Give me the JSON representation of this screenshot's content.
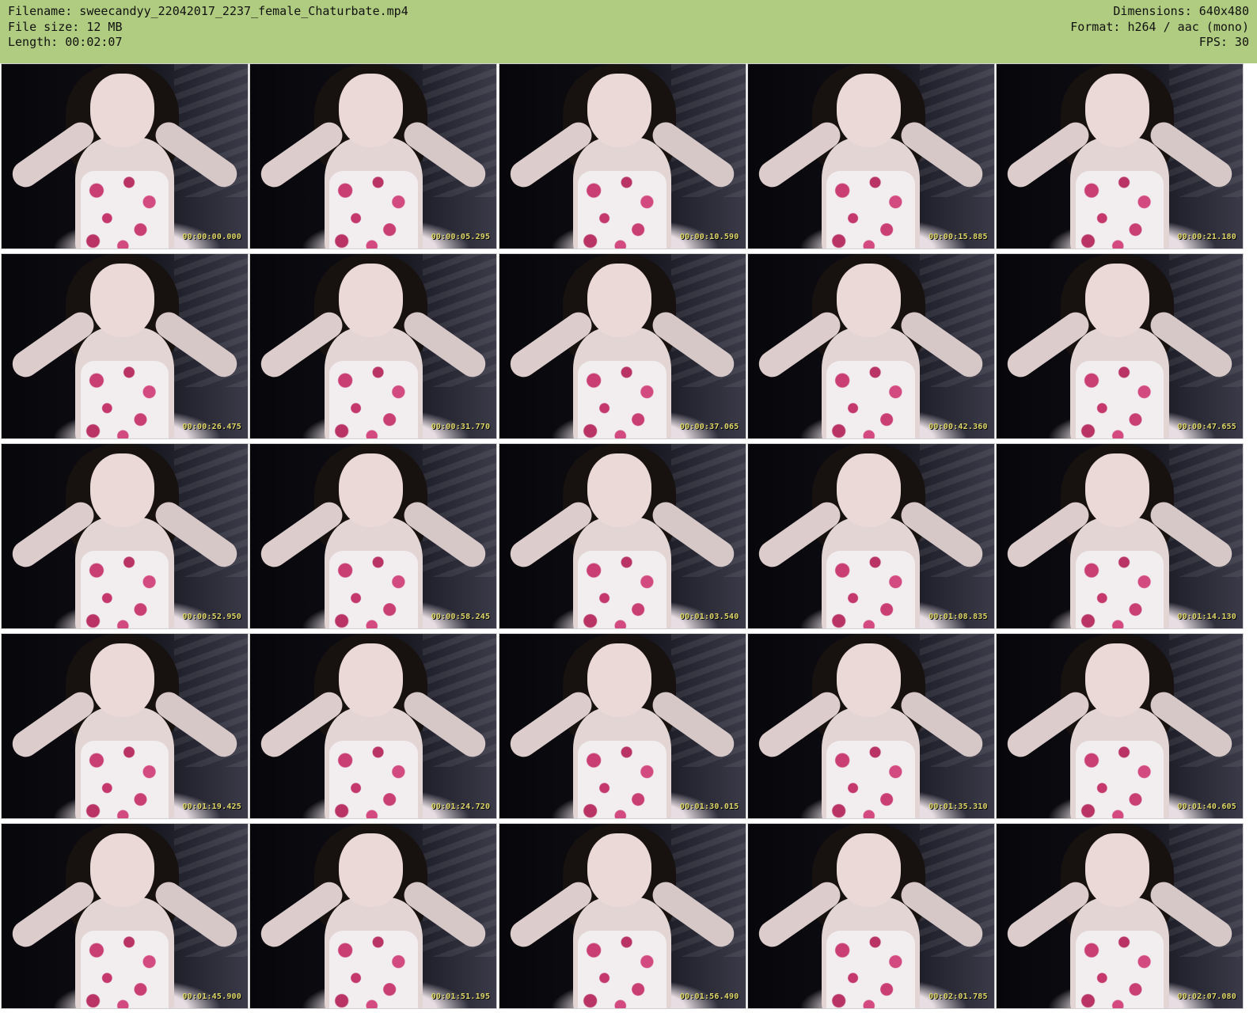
{
  "colors": {
    "header_bg": "#b0cc80",
    "header_text": "#111111",
    "timestamp_text": "#e0d86a"
  },
  "header": {
    "filename_line": "Filename: sweecandyy_22042017_2237_female_Chaturbate.mp4",
    "filesize_line": "File size: 12 MB",
    "length_line": "Length: 00:02:07",
    "dimensions_line": "Dimensions: 640x480",
    "format_line": "Format: h264 / aac (mono)",
    "fps_line": "FPS: 30"
  },
  "thumbnails": [
    {
      "timestamp": "00:00:00.000"
    },
    {
      "timestamp": "00:00:05.295"
    },
    {
      "timestamp": "00:00:10.590"
    },
    {
      "timestamp": "00:00:15.885"
    },
    {
      "timestamp": "00:00:21.180"
    },
    {
      "timestamp": "00:00:26.475"
    },
    {
      "timestamp": "00:00:31.770"
    },
    {
      "timestamp": "00:00:37.065"
    },
    {
      "timestamp": "00:00:42.360"
    },
    {
      "timestamp": "00:00:47.655"
    },
    {
      "timestamp": "00:00:52.950"
    },
    {
      "timestamp": "00:00:58.245"
    },
    {
      "timestamp": "00:01:03.540"
    },
    {
      "timestamp": "00:01:08.835"
    },
    {
      "timestamp": "00:01:14.130"
    },
    {
      "timestamp": "00:01:19.425"
    },
    {
      "timestamp": "00:01:24.720"
    },
    {
      "timestamp": "00:01:30.015"
    },
    {
      "timestamp": "00:01:35.310"
    },
    {
      "timestamp": "00:01:40.605"
    },
    {
      "timestamp": "00:01:45.900"
    },
    {
      "timestamp": "00:01:51.195"
    },
    {
      "timestamp": "00:01:56.490"
    },
    {
      "timestamp": "00:02:01.785"
    },
    {
      "timestamp": "00:02:07.080"
    }
  ]
}
